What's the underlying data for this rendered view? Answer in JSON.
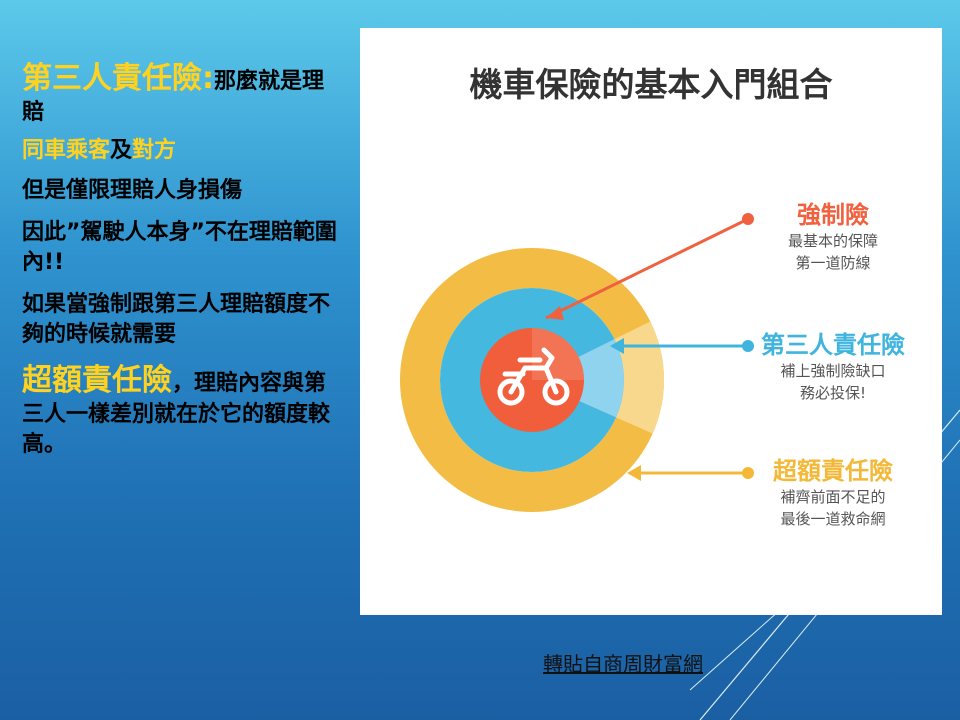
{
  "left": {
    "p1_title": "第三人責任險:",
    "p1_rest": "那麼就是理賠",
    "p2_a": "同車乘客",
    "p2_b": "及",
    "p2_c": "對方",
    "p3": "但是僅限理賠人身損傷",
    "p4": "因此”駕駛人本身”不在理賠範圍內!!",
    "p5": "如果當強制跟第三人理賠額度不夠的時候就需要",
    "p6_title": "超額責任險",
    "p6_rest": "，理賠內容與第三人一樣差別就在於它的額度較高。"
  },
  "diagram": {
    "title": "機車保險的基本入門組合",
    "items": [
      {
        "title": "強制險",
        "desc1": "最基本的保障",
        "desc2": "第一道防線",
        "color": "#f0623f"
      },
      {
        "title": "第三人責任險",
        "desc1": "補上強制險缺口",
        "desc2": "務必投保!",
        "color": "#3fb4de"
      },
      {
        "title": "超額責任險",
        "desc1": "補齊前面不足的",
        "desc2": "最後一道救命網",
        "color": "#f4b838"
      }
    ],
    "center_icon": "motorcycle-icon"
  },
  "credit": "轉貼自商周財富網"
}
